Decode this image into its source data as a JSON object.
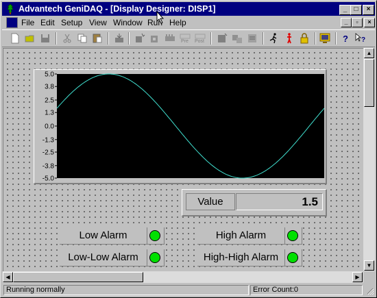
{
  "window": {
    "title": "Advantech GeniDAQ - [Display Designer: DISP1]"
  },
  "menu": {
    "items": [
      "File",
      "Edit",
      "Setup",
      "View",
      "Window",
      "Run",
      "Help"
    ]
  },
  "toolbar": {
    "icons": [
      "new-icon",
      "open-icon",
      "save-icon",
      "cut-icon",
      "copy-icon",
      "paste-icon",
      "import-icon",
      "tool-a-icon",
      "tool-b-icon",
      "tool-c-icon",
      "pre-icon",
      "post-icon",
      "tool-d-icon",
      "tool-e-icon",
      "tool-f-icon",
      "run-icon",
      "stop-icon",
      "lock-icon",
      "monitor-icon",
      "help-icon",
      "context-help-icon"
    ]
  },
  "chart_data": {
    "type": "line",
    "title": "",
    "xlabel": "",
    "ylabel": "",
    "ylim": [
      -5.0,
      5.0
    ],
    "y_ticks": [
      "5.0",
      "3.8",
      "2.5",
      "1.3",
      "0.0",
      "-1.3",
      "-2.5",
      "-3.8",
      "-5.0"
    ],
    "series": [
      {
        "shape": "sine",
        "amplitude": 5.0,
        "phase_start_deg": 20,
        "phase_end_deg": 380,
        "color": "#40e0d0"
      }
    ],
    "background": "#000000",
    "grid": false
  },
  "value_display": {
    "label": "Value",
    "value": "1.5"
  },
  "alarms": [
    {
      "label": "Low Alarm",
      "state": "off"
    },
    {
      "label": "High Alarm",
      "state": "off"
    },
    {
      "label": "Low-Low Alarm",
      "state": "off"
    },
    {
      "label": "High-High Alarm",
      "state": "off"
    }
  ],
  "status": {
    "message": "Running normally",
    "error_count": "Error Count:0"
  },
  "colors": {
    "title_bar": "#000080",
    "lamp_green": "#00e000",
    "trace": "#40e0d0"
  }
}
